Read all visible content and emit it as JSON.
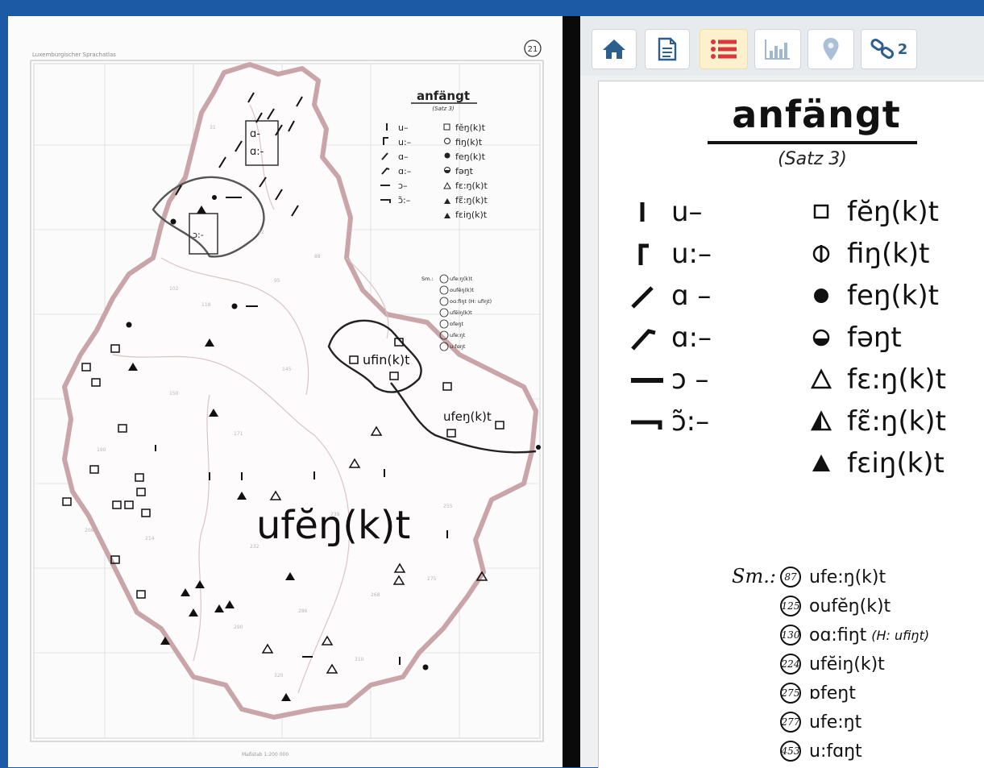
{
  "map": {
    "header_left": "Luxemburgischer Sprachatlas",
    "page_number": "21",
    "title": "anfängt",
    "subtitle": "(Satz 3)",
    "big_label": "ufĕŋ(k)t",
    "region_label_east": "ufin(k)t",
    "region_label_southeast": "ufeŋ(k)t",
    "box_label_1": "ɑ-",
    "box_label_2": "ɑ:-",
    "box_label_3": "ɔ:-",
    "footer": "Maßstab 1:200 000",
    "legend_left": [
      "u–",
      "u:–",
      "ɑ–",
      "ɑ:–",
      "ɔ–",
      "ɔ̃:–"
    ],
    "legend_right": [
      "fĕŋ(k)t",
      "fiŋ(k)t",
      "feŋ(k)t",
      "fəŋt",
      "fɛ:ŋ(k)t",
      "fɛ̃:ŋ(k)t",
      "fɛiŋ(k)t"
    ],
    "sm_items": [
      "ufe:ŋ(k)t",
      "oufĕŋ(k)t",
      "oɑ:fiŋt (H: ufiŋt)",
      "ufĕiŋ(k)t",
      "ɒfeŋt",
      "ufe:ŋt",
      "u:fɑŋt"
    ]
  },
  "toolbar": {
    "buttons": [
      {
        "name": "home",
        "icon": "home-icon"
      },
      {
        "name": "document",
        "icon": "document-icon"
      },
      {
        "name": "list",
        "icon": "list-icon",
        "active": true
      },
      {
        "name": "chart",
        "icon": "bar-chart-icon",
        "disabled": true
      },
      {
        "name": "location",
        "icon": "map-pin-icon",
        "disabled": true
      },
      {
        "name": "links",
        "icon": "link-icon",
        "count": "2"
      }
    ]
  },
  "legend": {
    "title": "anfängt",
    "subtitle": "(Satz 3)",
    "left_items": [
      {
        "symbol": "vertical-bar",
        "label": "u–"
      },
      {
        "symbol": "corner-bar",
        "label": "u:–"
      },
      {
        "symbol": "slash",
        "label": "ɑ –"
      },
      {
        "symbol": "hook-slash",
        "label": "ɑ:–"
      },
      {
        "symbol": "dash",
        "label": "ɔ –"
      },
      {
        "symbol": "hook-dash",
        "label": "ɔ̃:–"
      }
    ],
    "right_items": [
      {
        "symbol": "square-outline",
        "label": "fĕŋ(k)t"
      },
      {
        "symbol": "circle-bar",
        "label": "fiŋ(k)t"
      },
      {
        "symbol": "filled-circle",
        "label": "feŋ(k)t"
      },
      {
        "symbol": "half-circle",
        "label": "fəŋt"
      },
      {
        "symbol": "triangle-outline",
        "label": "fɛ:ŋ(k)t"
      },
      {
        "symbol": "triangle-half",
        "label": "fɛ̃:ŋ(k)t"
      },
      {
        "symbol": "triangle-filled",
        "label": "fɛiŋ(k)t"
      }
    ],
    "sm_label": "Sm.:",
    "sm_items": [
      {
        "num": "87",
        "text": "ufe:ŋ(k)t",
        "note": ""
      },
      {
        "num": "125",
        "text": "oufĕŋ(k)t",
        "note": ""
      },
      {
        "num": "130",
        "text": "oɑ:fiŋt",
        "note": "(H: ufiŋt)"
      },
      {
        "num": "224",
        "text": "ufĕiŋ(k)t",
        "note": ""
      },
      {
        "num": "275",
        "text": "ɒfeŋt",
        "note": ""
      },
      {
        "num": "277",
        "text": "ufe:ŋt",
        "note": ""
      },
      {
        "num": "453",
        "text": "u:fɑŋt",
        "note": ""
      }
    ]
  },
  "colors": {
    "frame": "#1c5aa6",
    "border": "#c9a5aa",
    "active_tab": "#fdf0cc",
    "accent": "#d9363e"
  }
}
